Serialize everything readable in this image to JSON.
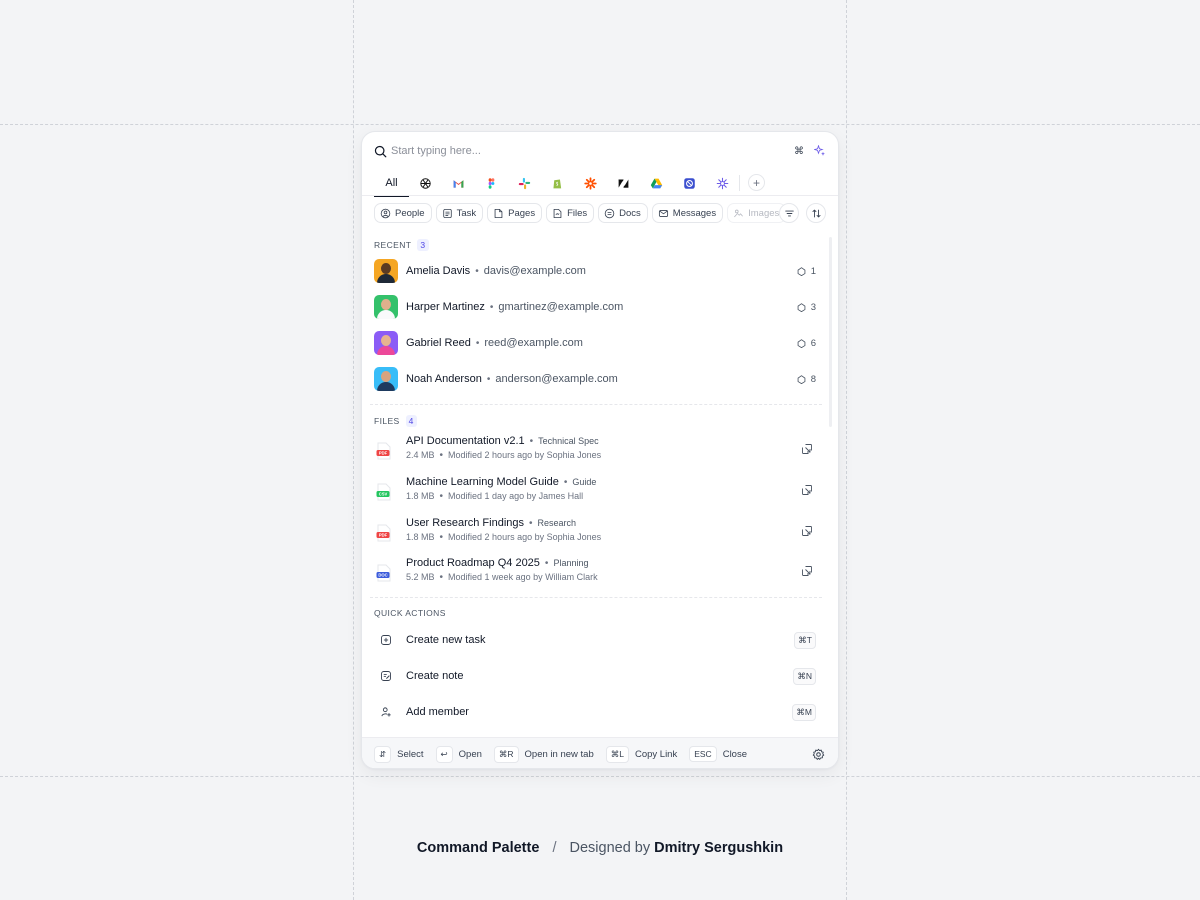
{
  "search": {
    "placeholder": "Start typing here...",
    "shortcut": "⌘"
  },
  "app_tabs": {
    "all_label": "All",
    "apps": [
      {
        "icon": "openai-icon"
      },
      {
        "icon": "gmail-icon"
      },
      {
        "icon": "figma-icon"
      },
      {
        "icon": "slack-icon"
      },
      {
        "icon": "shopify-icon"
      },
      {
        "icon": "zapier-icon"
      },
      {
        "icon": "zendesk-icon"
      },
      {
        "icon": "google-drive-icon"
      },
      {
        "icon": "linear-icon"
      },
      {
        "icon": "perplexity-icon"
      }
    ],
    "add_label": "+"
  },
  "filters": {
    "chips": [
      {
        "label": "People",
        "icon": "person-icon"
      },
      {
        "label": "Task",
        "icon": "task-icon"
      },
      {
        "label": "Pages",
        "icon": "pages-icon"
      },
      {
        "label": "Files",
        "icon": "file-icon"
      },
      {
        "label": "Docs",
        "icon": "docs-icon"
      },
      {
        "label": "Messages",
        "icon": "mail-icon"
      },
      {
        "label": "Images",
        "icon": "image-icon"
      }
    ]
  },
  "recent": {
    "label": "RECENT",
    "count": "3",
    "people": [
      {
        "name": "Amelia Davis",
        "email": "davis@example.com",
        "comments": "1",
        "avatar_color": "#f5a623"
      },
      {
        "name": "Harper Martinez",
        "email": "gmartinez@example.com",
        "comments": "3",
        "avatar_color": "#34c16b"
      },
      {
        "name": "Gabriel Reed",
        "email": "reed@example.com",
        "comments": "6",
        "avatar_color": "#8b5cf6"
      },
      {
        "name": "Noah Anderson",
        "email": "anderson@example.com",
        "comments": "8",
        "avatar_color": "#38bdf8"
      }
    ]
  },
  "files": {
    "label": "FILES",
    "count": "4",
    "items": [
      {
        "title": "API Documentation v2.1",
        "tag": "Technical Spec",
        "size": "2.4 MB",
        "modified": "Modified 2 hours ago by Sophia Jones",
        "type": "PDF",
        "type_color": "#ef4444"
      },
      {
        "title": "Machine Learning Model Guide",
        "tag": "Guide",
        "size": "1.8 MB",
        "modified": "Modified 1 day ago by James Hall",
        "type": "CSV",
        "type_color": "#22c55e"
      },
      {
        "title": "User Research Findings",
        "tag": "Research",
        "size": "1.8 MB",
        "modified": "Modified 2 hours ago by Sophia Jones",
        "type": "PDF",
        "type_color": "#ef4444"
      },
      {
        "title": "Product Roadmap Q4 2025",
        "tag": "Planning",
        "size": "5.2 MB",
        "modified": "Modified 1 week ago by William Clark",
        "type": "DOC",
        "type_color": "#3b5bdb"
      }
    ]
  },
  "quick_actions": {
    "label": "QUICK ACTIONS",
    "items": [
      {
        "label": "Create new task",
        "shortcut": "⌘T"
      },
      {
        "label": "Create note",
        "shortcut": "⌘N"
      },
      {
        "label": "Add member",
        "shortcut": "⌘M"
      }
    ]
  },
  "footer": {
    "hints": [
      {
        "key": "⇵",
        "label": "Select"
      },
      {
        "key": "↩",
        "label": "Open"
      },
      {
        "key": "⌘R",
        "label": "Open in new tab"
      },
      {
        "key": "⌘L",
        "label": "Copy Link"
      },
      {
        "key": "ESC",
        "label": "Close"
      }
    ]
  },
  "caption": {
    "title": "Command Palette",
    "separator": "/",
    "designed_by": "Designed by",
    "author": "Dmitry Sergushkin"
  }
}
